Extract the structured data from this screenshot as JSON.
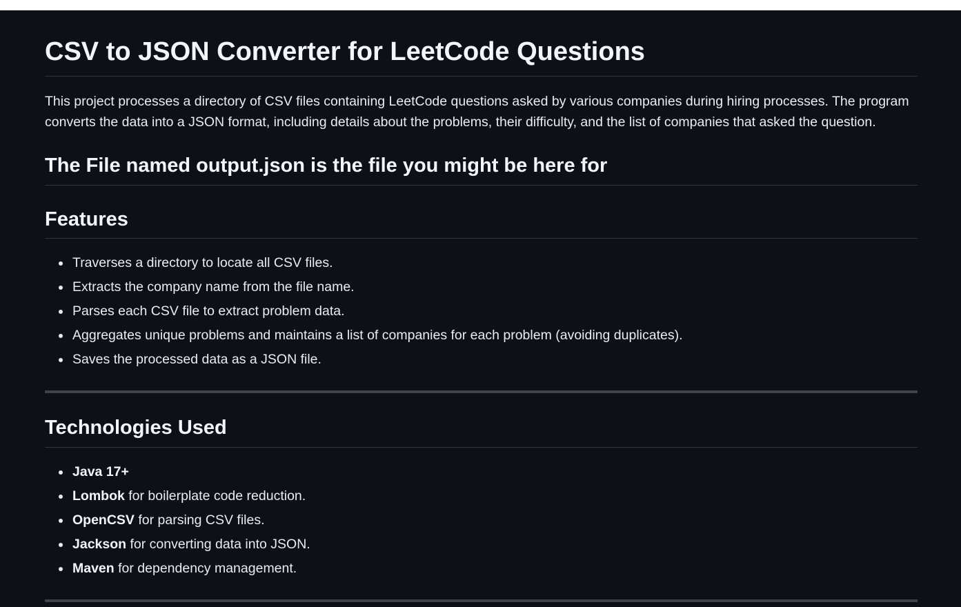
{
  "readme": {
    "title": "CSV to JSON Converter for LeetCode Questions",
    "intro": "This project processes a directory of CSV files containing LeetCode questions asked by various companies during hiring processes. The program converts the data into a JSON format, including details about the problems, their difficulty, and the list of companies that asked the question.",
    "output_heading": "The File named output.json is the file you might be here for",
    "features": {
      "heading": "Features",
      "items": [
        "Traverses a directory to locate all CSV files.",
        "Extracts the company name from the file name.",
        "Parses each CSV file to extract problem data.",
        "Aggregates unique problems and maintains a list of companies for each problem (avoiding duplicates).",
        "Saves the processed data as a JSON file."
      ]
    },
    "technologies": {
      "heading": "Technologies Used",
      "items": [
        {
          "name": "Java 17+",
          "desc": ""
        },
        {
          "name": "Lombok",
          "desc": " for boilerplate code reduction."
        },
        {
          "name": "OpenCSV",
          "desc": " for parsing CSV files."
        },
        {
          "name": "Jackson",
          "desc": " for converting data into JSON."
        },
        {
          "name": "Maven",
          "desc": " for dependency management."
        }
      ]
    }
  },
  "colors": {
    "background": "#0d1117",
    "text": "#e6edf3",
    "divider": "#30363d"
  }
}
